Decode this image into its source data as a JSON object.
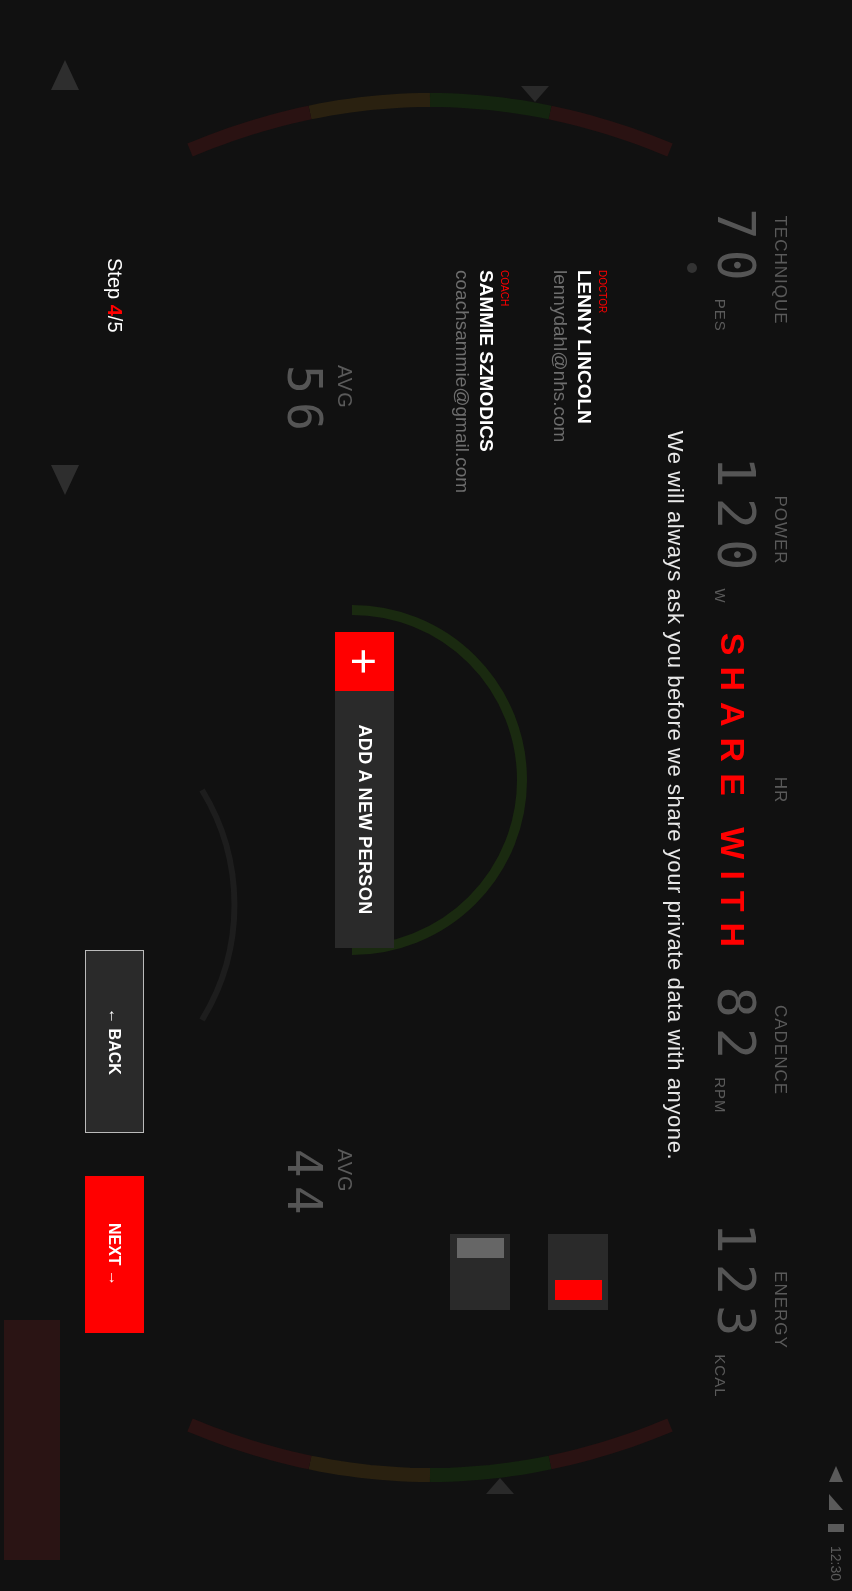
{
  "status_bar": {
    "time": "12:30"
  },
  "dashboard": {
    "stats": [
      {
        "label": "TECHNIQUE",
        "value": "70",
        "unit": "PES"
      },
      {
        "label": "POWER",
        "value": "120",
        "unit": "W"
      },
      {
        "label": "HR"
      },
      {
        "label": "CADENCE",
        "value": "82",
        "unit": "RPM"
      },
      {
        "label": "ENERGY",
        "value": "123",
        "unit": "KCAL"
      }
    ],
    "averages": [
      {
        "label": "AVG",
        "value": "56"
      },
      {
        "label": "AVG",
        "value": "44"
      }
    ]
  },
  "dialog": {
    "title": "SHARE WITH",
    "subtitle": "We will always ask you before we share your private data with anyone.",
    "contacts": [
      {
        "role": "DOCTOR",
        "name": "LENNY LINCOLN",
        "email": "lennydahl@nhs.com",
        "on": true
      },
      {
        "role": "COACH",
        "name": "SAMMIE SZMODICS",
        "email": "coachsammie@gmail.com",
        "on": false
      }
    ],
    "add_button": {
      "icon": "+",
      "label": "ADD A NEW PERSON"
    }
  },
  "footer": {
    "step": "Step **4**/5",
    "back": "← BACK",
    "next": "NEXT →"
  }
}
